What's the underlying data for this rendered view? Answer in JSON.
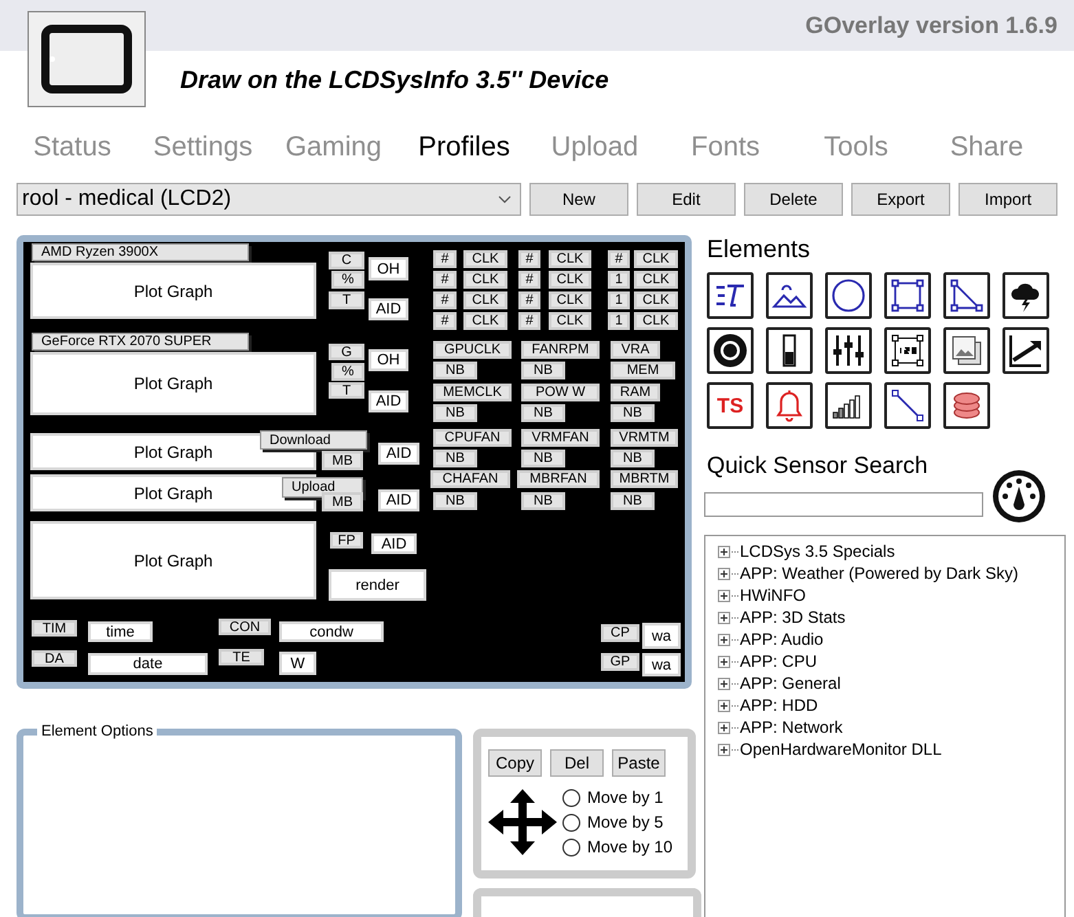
{
  "app": {
    "version": "GOverlay version 1.6.9",
    "title": "Draw on the LCDSysInfo 3.5'' Device"
  },
  "tabs": [
    {
      "label": "Status",
      "selected": false
    },
    {
      "label": "Settings",
      "selected": false
    },
    {
      "label": "Gaming",
      "selected": false
    },
    {
      "label": "Profiles",
      "selected": true
    },
    {
      "label": "Upload",
      "selected": false
    },
    {
      "label": "Fonts",
      "selected": false
    },
    {
      "label": "Tools",
      "selected": false
    },
    {
      "label": "Share",
      "selected": false
    }
  ],
  "profile": {
    "value": "rool - medical (LCD2)",
    "buttons": [
      "New",
      "Edit",
      "Delete",
      "Export",
      "Import"
    ]
  },
  "canvas": {
    "items": [
      {
        "kind": "title",
        "text": "AMD Ryzen 3900X"
      },
      {
        "kind": "graph",
        "text": "Plot Graph"
      },
      {
        "kind": "tag",
        "text": "C"
      },
      {
        "kind": "tag",
        "text": "%"
      },
      {
        "kind": "tag",
        "text": "T"
      },
      {
        "kind": "value",
        "text": "OH"
      },
      {
        "kind": "value",
        "text": "AID"
      },
      {
        "kind": "title",
        "text": "GeForce RTX 2070 SUPER"
      },
      {
        "kind": "graph",
        "text": "Plot Graph"
      },
      {
        "kind": "tag",
        "text": "G"
      },
      {
        "kind": "tag",
        "text": "%"
      },
      {
        "kind": "tag",
        "text": "T"
      },
      {
        "kind": "value",
        "text": "OH"
      },
      {
        "kind": "value",
        "text": "AID"
      },
      {
        "kind": "graph",
        "text": "Plot Graph"
      },
      {
        "kind": "title",
        "text": "Download"
      },
      {
        "kind": "tag",
        "text": "MB"
      },
      {
        "kind": "value",
        "text": "AID"
      },
      {
        "kind": "graph",
        "text": "Plot Graph"
      },
      {
        "kind": "title",
        "text": "Upload"
      },
      {
        "kind": "tag",
        "text": "MB"
      },
      {
        "kind": "value",
        "text": "AID"
      },
      {
        "kind": "graph",
        "text": "Plot Graph"
      },
      {
        "kind": "tag",
        "text": "FP"
      },
      {
        "kind": "value",
        "text": "AID"
      },
      {
        "kind": "value",
        "text": "render"
      },
      {
        "kind": "tag",
        "text": "TIM"
      },
      {
        "kind": "value",
        "text": "time"
      },
      {
        "kind": "tag",
        "text": "CON"
      },
      {
        "kind": "value",
        "text": "condw"
      },
      {
        "kind": "tag",
        "text": "DA"
      },
      {
        "kind": "value",
        "text": "date"
      },
      {
        "kind": "tag",
        "text": "TE"
      },
      {
        "kind": "value",
        "text": "W"
      },
      {
        "kind": "tag",
        "text": "#"
      },
      {
        "kind": "tag",
        "text": "CLK"
      },
      {
        "kind": "tag",
        "text": "#"
      },
      {
        "kind": "tag",
        "text": "CLK"
      },
      {
        "kind": "tag",
        "text": "#"
      },
      {
        "kind": "tag",
        "text": "CLK"
      },
      {
        "kind": "tag",
        "text": "#"
      },
      {
        "kind": "tag",
        "text": "CLK"
      },
      {
        "kind": "tag",
        "text": "#"
      },
      {
        "kind": "tag",
        "text": "CLK"
      },
      {
        "kind": "tag",
        "text": "1"
      },
      {
        "kind": "tag",
        "text": "CLK"
      },
      {
        "kind": "tag",
        "text": "#"
      },
      {
        "kind": "tag",
        "text": "CLK"
      },
      {
        "kind": "tag",
        "text": "#"
      },
      {
        "kind": "tag",
        "text": "CLK"
      },
      {
        "kind": "tag",
        "text": "1"
      },
      {
        "kind": "tag",
        "text": "CLK"
      },
      {
        "kind": "tag",
        "text": "#"
      },
      {
        "kind": "tag",
        "text": "CLK"
      },
      {
        "kind": "tag",
        "text": "#"
      },
      {
        "kind": "tag",
        "text": "CLK"
      },
      {
        "kind": "tag",
        "text": "1"
      },
      {
        "kind": "tag",
        "text": "CLK"
      },
      {
        "kind": "tag",
        "text": "GPUCLK"
      },
      {
        "kind": "tag",
        "text": "FANRPM"
      },
      {
        "kind": "tag",
        "text": "VRA"
      },
      {
        "kind": "tag",
        "text": "NB"
      },
      {
        "kind": "tag",
        "text": "NB"
      },
      {
        "kind": "tag",
        "text": "MEM"
      },
      {
        "kind": "tag",
        "text": "MEMCLK"
      },
      {
        "kind": "tag",
        "text": "POW W"
      },
      {
        "kind": "tag",
        "text": "RAM"
      },
      {
        "kind": "tag",
        "text": "NB"
      },
      {
        "kind": "tag",
        "text": "NB"
      },
      {
        "kind": "tag",
        "text": "NB"
      },
      {
        "kind": "tag",
        "text": "CPUFAN"
      },
      {
        "kind": "tag",
        "text": "VRMFAN"
      },
      {
        "kind": "tag",
        "text": "VRMTM"
      },
      {
        "kind": "tag",
        "text": "NB"
      },
      {
        "kind": "tag",
        "text": "NB"
      },
      {
        "kind": "tag",
        "text": "NB"
      },
      {
        "kind": "tag",
        "text": "CHAFAN"
      },
      {
        "kind": "tag",
        "text": "MBRFAN"
      },
      {
        "kind": "tag",
        "text": "MBRTM"
      },
      {
        "kind": "tag",
        "text": "NB"
      },
      {
        "kind": "tag",
        "text": "NB"
      },
      {
        "kind": "tag",
        "text": "NB"
      },
      {
        "kind": "tag",
        "text": "CP"
      },
      {
        "kind": "value",
        "text": "wa"
      },
      {
        "kind": "tag",
        "text": "GP"
      },
      {
        "kind": "value",
        "text": "wa"
      }
    ]
  },
  "elements": {
    "title": "Elements",
    "ts_label": "TS"
  },
  "sensor_search": {
    "label": "Quick Sensor Search"
  },
  "tree": [
    {
      "label": "LCDSys 3.5 Specials",
      "expanded": false
    },
    {
      "label": "APP: Weather (Powered by Dark Sky)",
      "expanded": false
    },
    {
      "label": "HWiNFO",
      "expanded": false
    },
    {
      "label": "APP: 3D Stats",
      "expanded": false
    },
    {
      "label": "APP: Audio",
      "expanded": false
    },
    {
      "label": "APP: CPU",
      "expanded": false
    },
    {
      "label": "APP: General",
      "expanded": false
    },
    {
      "label": "APP: HDD",
      "expanded": false
    },
    {
      "label": "APP: Network",
      "expanded": false
    },
    {
      "label": "OpenHardwareMonitor DLL",
      "expanded": false
    }
  ],
  "element_options": {
    "title": "Element Options"
  },
  "move": {
    "buttons": [
      "Copy",
      "Del",
      "Paste"
    ],
    "steps": [
      {
        "label": "Move by 1",
        "selected": false
      },
      {
        "label": "Move by 5",
        "selected": false
      },
      {
        "label": "Move by 10",
        "selected": false
      }
    ]
  }
}
